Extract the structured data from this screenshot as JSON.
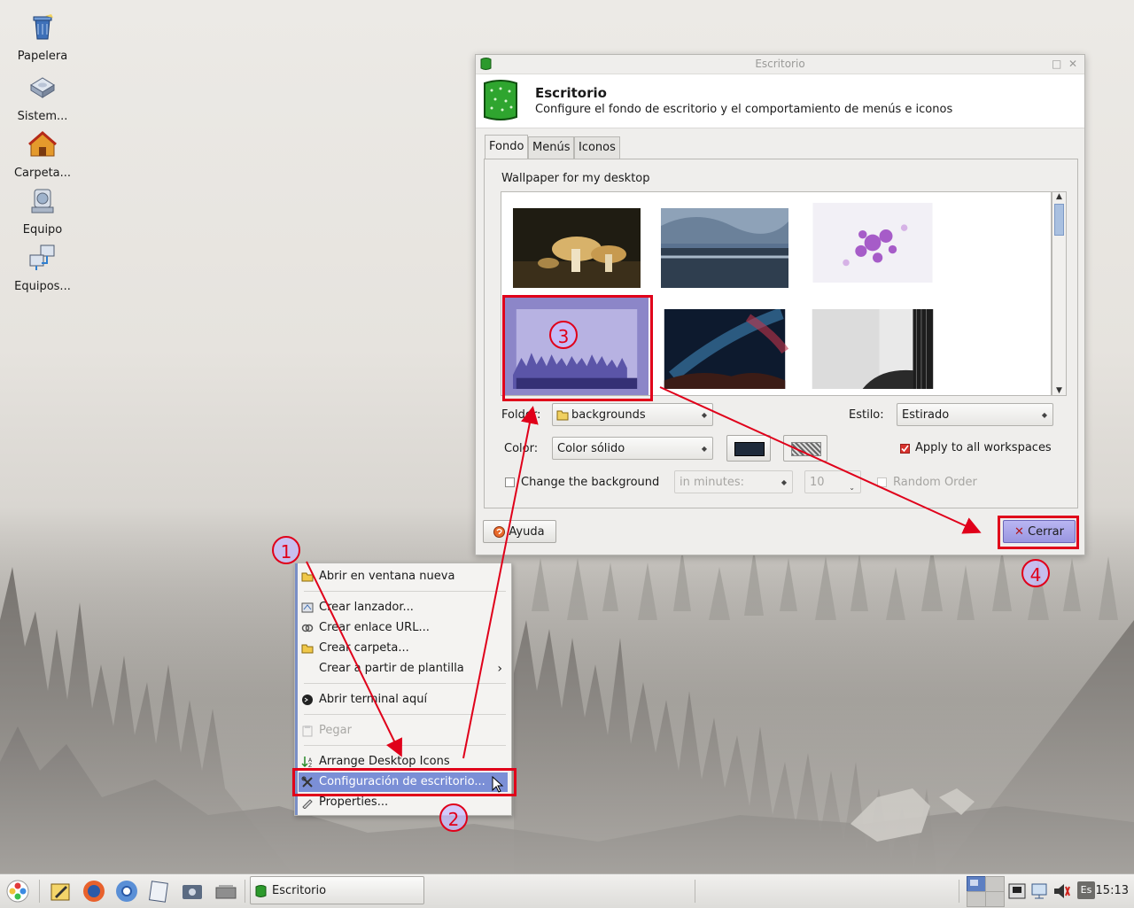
{
  "desktop": {
    "icons": [
      {
        "label": "Papelera",
        "icon": "trash-icon"
      },
      {
        "label": "Sistem...",
        "icon": "drive-icon"
      },
      {
        "label": "Carpeta...",
        "icon": "home-folder-icon"
      },
      {
        "label": "Equipo",
        "icon": "computer-icon"
      },
      {
        "label": "Equipos...",
        "icon": "network-icon"
      }
    ]
  },
  "window": {
    "title": "Escritorio",
    "header_title": "Escritorio",
    "header_subtitle": "Configure el fondo de escritorio y el comportamiento de menús e iconos",
    "tabs": [
      "Fondo",
      "Menús",
      "Iconos"
    ],
    "active_tab": "Fondo",
    "section_label": "Wallpaper for my desktop",
    "wallpapers": [
      "mushrooms",
      "stormy-beach",
      "purple-flowers",
      "foggy-violet-forest",
      "night-sky",
      "guitar"
    ],
    "selected_wallpaper": "foggy-violet-forest",
    "folder_label": "Folder:",
    "folder_value": "backgrounds",
    "style_label": "Estilo:",
    "style_value": "Estirado",
    "color_label": "Color:",
    "color_value": "Color sólido",
    "color_swatch": "#1e2a3a",
    "apply_all_label": "Apply to all workspaces",
    "apply_all_checked": true,
    "change_bg_label": "Change the background",
    "change_bg_checked": false,
    "interval_unit": "in minutes:",
    "interval_value": "10",
    "random_order_label": "Random Order",
    "help_button": "Ayuda",
    "close_button": "Cerrar"
  },
  "context_menu": {
    "items": [
      {
        "label": "Abrir en ventana nueva",
        "icon": "folder-open-icon"
      },
      {
        "label": "Crear lanzador...",
        "icon": "launcher-icon"
      },
      {
        "label": "Crear enlace URL...",
        "icon": "link-icon"
      },
      {
        "label": "Crear carpeta...",
        "icon": "folder-icon"
      },
      {
        "label": "Crear a partir de plantilla",
        "icon": "template-icon"
      },
      {
        "label": "Abrir terminal aquí",
        "icon": "terminal-icon"
      },
      {
        "label": "Pegar",
        "icon": "paste-icon",
        "disabled": true
      },
      {
        "label": "Arrange Desktop Icons",
        "icon": "sort-icon"
      },
      {
        "label": "Configuración de escritorio...",
        "icon": "settings-icon",
        "selected": true
      },
      {
        "label": "Properties...",
        "icon": "properties-icon"
      }
    ]
  },
  "annotations": {
    "step1": "1",
    "step2": "2",
    "step3": "3",
    "step4": "4",
    "color": "#e0001a"
  },
  "taskbar": {
    "task_label": "Escritorio",
    "language": "Es",
    "clock": "15:13"
  }
}
